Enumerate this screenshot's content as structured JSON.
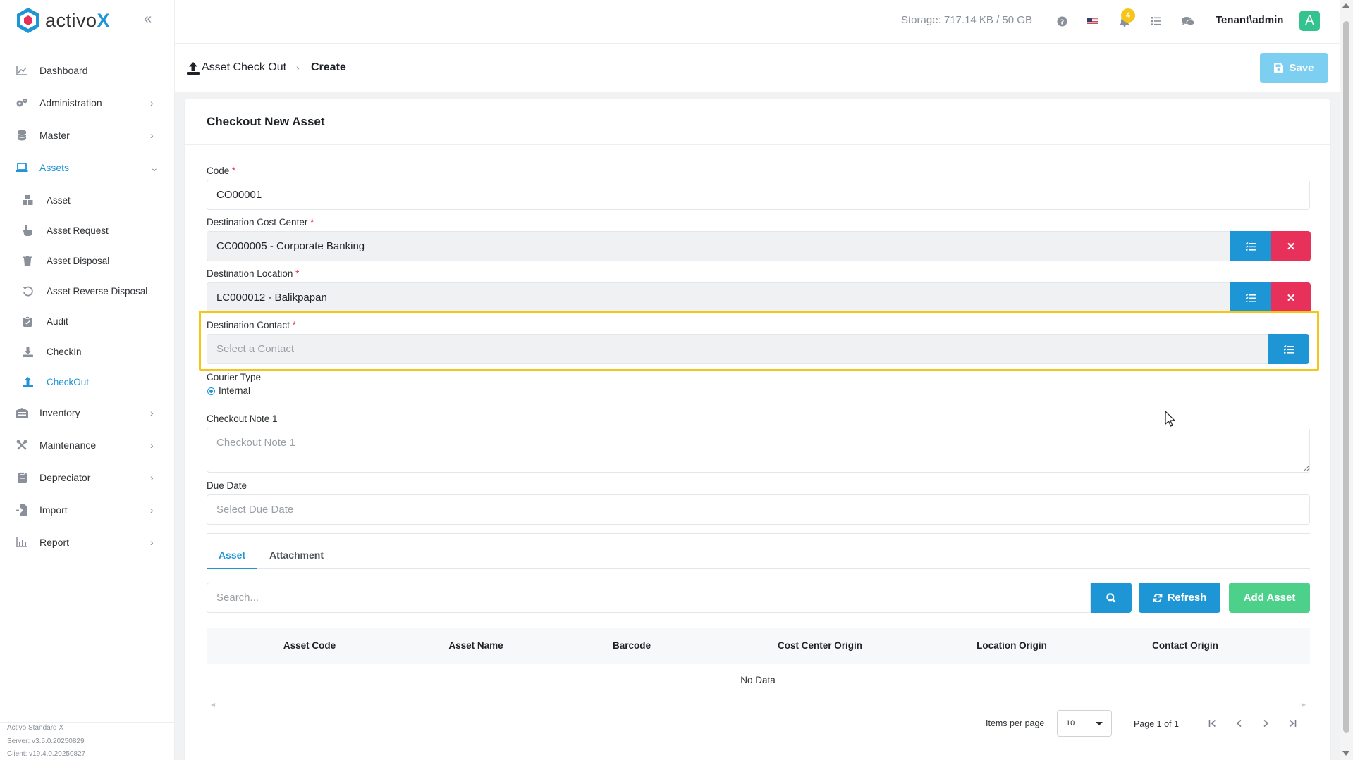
{
  "brand": {
    "name": "activo",
    "name_x": "X"
  },
  "sidebar": {
    "items": [
      {
        "label": "Dashboard",
        "icon": "chart-line-icon"
      },
      {
        "label": "Administration",
        "icon": "gears-icon"
      },
      {
        "label": "Master",
        "icon": "database-icon"
      },
      {
        "label": "Assets",
        "icon": "laptop-icon"
      },
      {
        "label": "Inventory",
        "icon": "warehouse-icon"
      },
      {
        "label": "Maintenance",
        "icon": "tools-icon"
      },
      {
        "label": "Depreciator",
        "icon": "clipboard-icon"
      },
      {
        "label": "Import",
        "icon": "file-import-icon"
      },
      {
        "label": "Report",
        "icon": "chart-bar-icon"
      }
    ],
    "assets_sub": [
      {
        "label": "Asset",
        "icon": "boxes-icon"
      },
      {
        "label": "Asset Request",
        "icon": "hand-pointer-icon"
      },
      {
        "label": "Asset Disposal",
        "icon": "trash-icon"
      },
      {
        "label": "Asset Reverse Disposal",
        "icon": "undo-icon"
      },
      {
        "label": "Audit",
        "icon": "clipboard-check-icon"
      },
      {
        "label": "CheckIn",
        "icon": "download-icon"
      },
      {
        "label": "CheckOut",
        "icon": "upload-icon"
      }
    ],
    "version": {
      "product": "Activo Standard X",
      "server": "Server: v3.5.0.20250829",
      "client": "Client: v19.4.0.20250827"
    }
  },
  "topbar": {
    "storage": "Storage: 717.14 KB / 50 GB",
    "notification_count": "4",
    "user": "Tenant\\admin",
    "avatar_letter": "A"
  },
  "breadcrumb": {
    "parent": "Asset Check Out",
    "current": "Create"
  },
  "toolbar": {
    "save_label": "Save"
  },
  "form": {
    "title": "Checkout New Asset",
    "code": {
      "label": "Code",
      "required": "*",
      "value": "CO00001"
    },
    "cost_center": {
      "label": "Destination Cost Center",
      "required": "*",
      "value": "CC000005 - Corporate Banking"
    },
    "location": {
      "label": "Destination Location",
      "required": "*",
      "value": "LC000012 - Balikpapan"
    },
    "contact": {
      "label": "Destination Contact",
      "required": "*",
      "placeholder": "Select a Contact"
    },
    "courier": {
      "label": "Courier Type",
      "option": "Internal"
    },
    "note": {
      "label": "Checkout Note 1",
      "placeholder": "Checkout Note 1"
    },
    "due_date": {
      "label": "Due Date",
      "placeholder": "Select Due Date"
    }
  },
  "tabs": [
    {
      "label": "Asset"
    },
    {
      "label": "Attachment"
    }
  ],
  "asset_table": {
    "search_placeholder": "Search...",
    "refresh_label": "Refresh",
    "add_label": "Add Asset",
    "columns": [
      "Asset Code",
      "Asset Name",
      "Barcode",
      "Cost Center Origin",
      "Location Origin",
      "Contact Origin"
    ],
    "empty": "No Data",
    "items_per_page_label": "Items per page",
    "items_per_page": "10",
    "page_info": "Page 1 of 1"
  },
  "colors": {
    "primary": "#1e96d6",
    "danger": "#e8315a",
    "success": "#4cd08a",
    "highlight": "#f5c518"
  }
}
